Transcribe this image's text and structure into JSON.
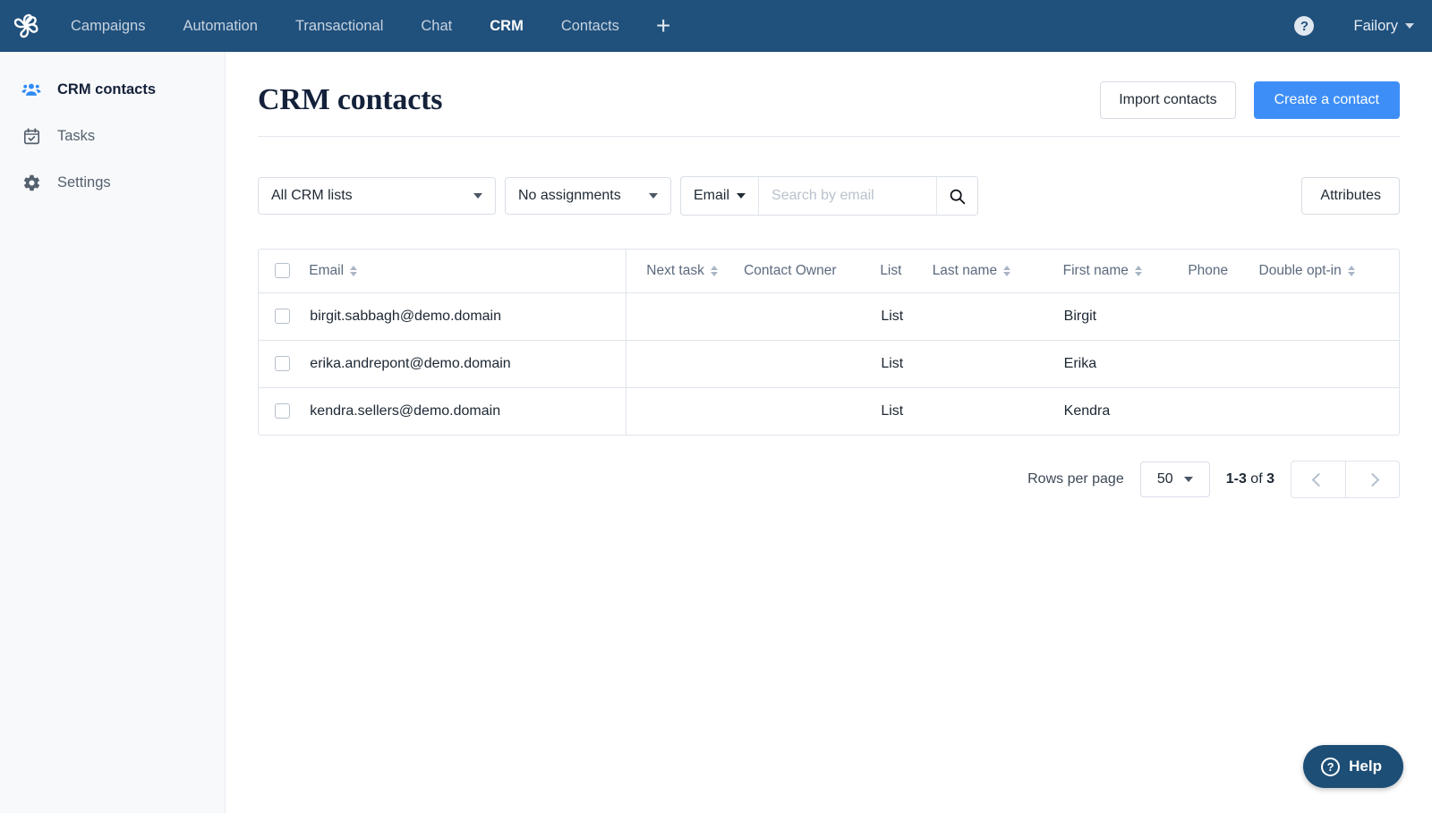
{
  "topnav": {
    "logo": "brevo-pinwheel-logo",
    "items": [
      {
        "label": "Campaigns",
        "active": false
      },
      {
        "label": "Automation",
        "active": false
      },
      {
        "label": "Transactional",
        "active": false
      },
      {
        "label": "Chat",
        "active": false
      },
      {
        "label": "CRM",
        "active": true
      },
      {
        "label": "Contacts",
        "active": false
      }
    ],
    "add_label": "+",
    "help_label": "?",
    "account_label": "Failory"
  },
  "sidebar": {
    "items": [
      {
        "label": "CRM contacts",
        "icon": "people-icon",
        "active": true
      },
      {
        "label": "Tasks",
        "icon": "calendar-check-icon",
        "active": false
      },
      {
        "label": "Settings",
        "icon": "gear-icon",
        "active": false
      }
    ]
  },
  "header": {
    "title": "CRM contacts",
    "import_label": "Import contacts",
    "create_label": "Create a contact"
  },
  "filters": {
    "list_select": "All CRM lists",
    "assignment_select": "No assignments",
    "search_type": "Email",
    "search_value": "",
    "search_placeholder": "Search by email",
    "attributes_label": "Attributes"
  },
  "table": {
    "columns": [
      {
        "key": "email",
        "label": "Email",
        "sortable": true
      },
      {
        "key": "next_task",
        "label": "Next task",
        "sortable": true
      },
      {
        "key": "contact_owner",
        "label": "Contact Owner",
        "sortable": false
      },
      {
        "key": "list",
        "label": "List",
        "sortable": false
      },
      {
        "key": "last_name",
        "label": "Last name",
        "sortable": true
      },
      {
        "key": "first_name",
        "label": "First name",
        "sortable": true
      },
      {
        "key": "phone",
        "label": "Phone",
        "sortable": false
      },
      {
        "key": "double_opt_in",
        "label": "Double opt-in",
        "sortable": true
      }
    ],
    "rows": [
      {
        "email": "birgit.sabbagh@demo.domain",
        "next_task": "",
        "contact_owner": "",
        "list": "List",
        "last_name": "",
        "first_name": "Birgit",
        "phone": "",
        "double_opt_in": ""
      },
      {
        "email": "erika.andrepont@demo.domain",
        "next_task": "",
        "contact_owner": "",
        "list": "List",
        "last_name": "",
        "first_name": "Erika",
        "phone": "",
        "double_opt_in": ""
      },
      {
        "email": "kendra.sellers@demo.domain",
        "next_task": "",
        "contact_owner": "",
        "list": "List",
        "last_name": "",
        "first_name": "Kendra",
        "phone": "",
        "double_opt_in": ""
      }
    ]
  },
  "pagination": {
    "rows_per_page_label": "Rows per page",
    "rows_per_page_value": "50",
    "range_start_end": "1-3",
    "range_of": " of ",
    "range_total": "3"
  },
  "help_widget": {
    "label": "Help",
    "icon": "question-circle-icon"
  },
  "colors": {
    "topnav_bg": "#20507c",
    "accent_blue": "#3e8ef7",
    "sidebar_bg": "#f8f9fb",
    "help_fab_bg": "#1d4e76",
    "border": "#dfe4ec"
  }
}
